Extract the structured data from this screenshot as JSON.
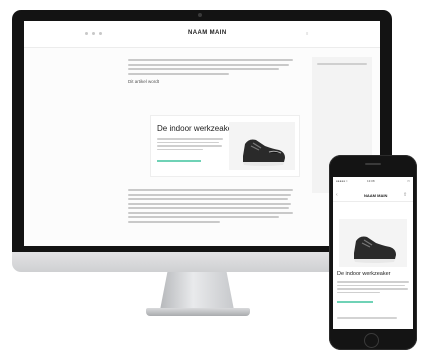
{
  "desktop": {
    "site": {
      "logo": "NAAM MAIN",
      "subheading": "Dit artikel wordt",
      "card": {
        "title": "De indoor werkzeaker"
      }
    }
  },
  "mobile": {
    "status": {
      "carrier": "●●●●● ≈",
      "time": "13:08",
      "battery": "▭"
    },
    "header": {
      "logo": "NAAM MAIN"
    },
    "card": {
      "title": "De indoor werkzeaker"
    }
  },
  "colors": {
    "accent": "#6fd2b6",
    "device_dark": "#131313"
  },
  "icons": {
    "shoe": "shoe-image",
    "back": "back-icon",
    "share": "share-icon"
  }
}
